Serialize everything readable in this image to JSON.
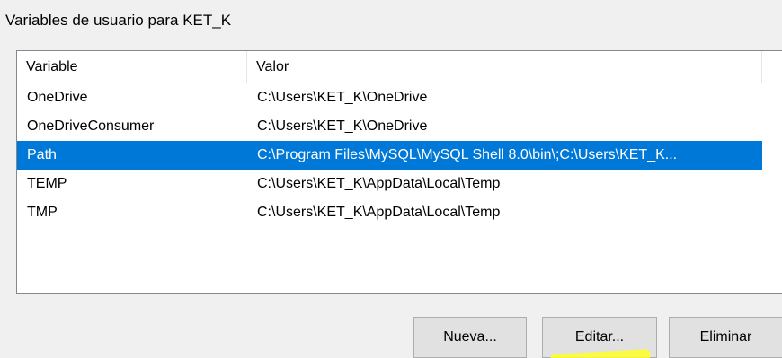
{
  "group": {
    "title": "Variables de usuario para KET_K"
  },
  "table": {
    "headers": [
      "Variable",
      "Valor"
    ],
    "rows": [
      {
        "variable": "OneDrive",
        "valor": "C:\\Users\\KET_K\\OneDrive",
        "selected": false
      },
      {
        "variable": "OneDriveConsumer",
        "valor": "C:\\Users\\KET_K\\OneDrive",
        "selected": false
      },
      {
        "variable": "Path",
        "valor": "C:\\Program Files\\MySQL\\MySQL Shell 8.0\\bin\\;C:\\Users\\KET_K...",
        "selected": true
      },
      {
        "variable": "TEMP",
        "valor": "C:\\Users\\KET_K\\AppData\\Local\\Temp",
        "selected": false
      },
      {
        "variable": "TMP",
        "valor": "C:\\Users\\KET_K\\AppData\\Local\\Temp",
        "selected": false
      }
    ]
  },
  "buttons": {
    "nueva": "Nueva...",
    "editar": "Editar...",
    "eliminar": "Eliminar"
  },
  "colors": {
    "selection": "#0078d7",
    "highlighter": "#ffff29"
  }
}
